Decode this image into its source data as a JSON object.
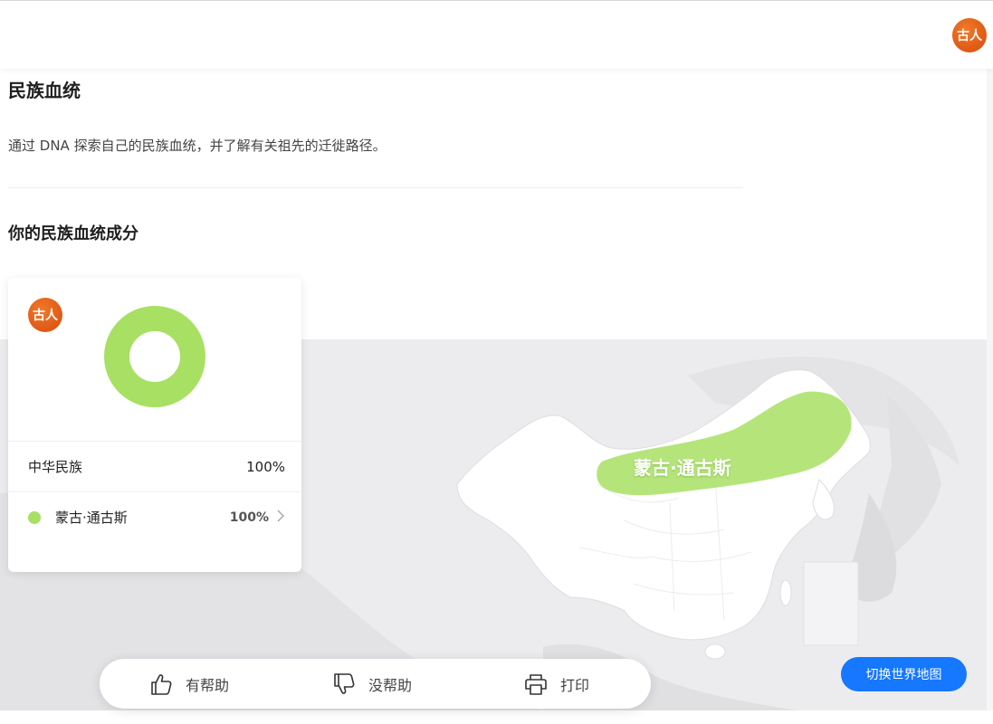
{
  "user": {
    "avatar_text": "古人"
  },
  "section": {
    "title": "民族血统",
    "description": "通过 DNA 探索自己的民族血统，并了解有关祖先的迁徙路径。",
    "composition_title": "你的民族血统成分"
  },
  "card": {
    "avatar_text": "古人",
    "total": {
      "name": "中华民族",
      "percent": "100%"
    },
    "items": [
      {
        "name": "蒙古·通古斯",
        "percent": "100%",
        "color": "#a8e063"
      }
    ],
    "donut_fraction": 1.0
  },
  "map": {
    "region_label": "蒙古·通古斯",
    "switch_button": "切换世界地图",
    "highlight_color": "#a8e063"
  },
  "feedback": {
    "helpful": "有帮助",
    "not_helpful": "没帮助",
    "print": "打印"
  }
}
